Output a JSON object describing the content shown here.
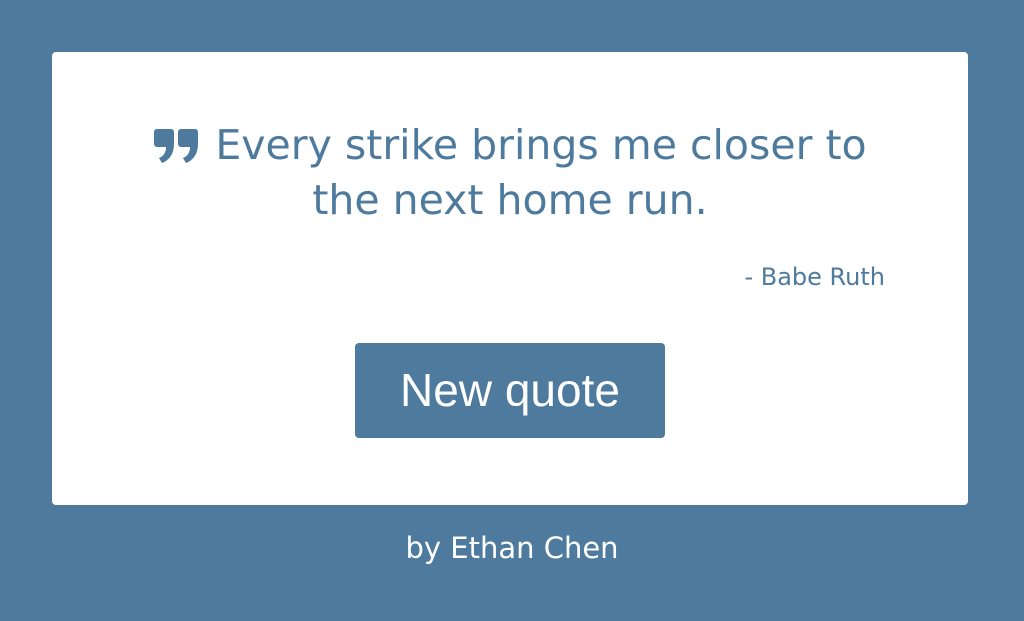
{
  "quote": {
    "text": "Every strike brings me closer to the next home run.",
    "author": "- Babe Ruth",
    "icon": "quote-left-icon"
  },
  "actions": {
    "new_quote_label": "New quote"
  },
  "footer": {
    "prefix": "by",
    "name": "Ethan Chen"
  },
  "colors": {
    "background": "#4d7a9d",
    "card": "#ffffff",
    "accent": "#4d7a9d"
  }
}
